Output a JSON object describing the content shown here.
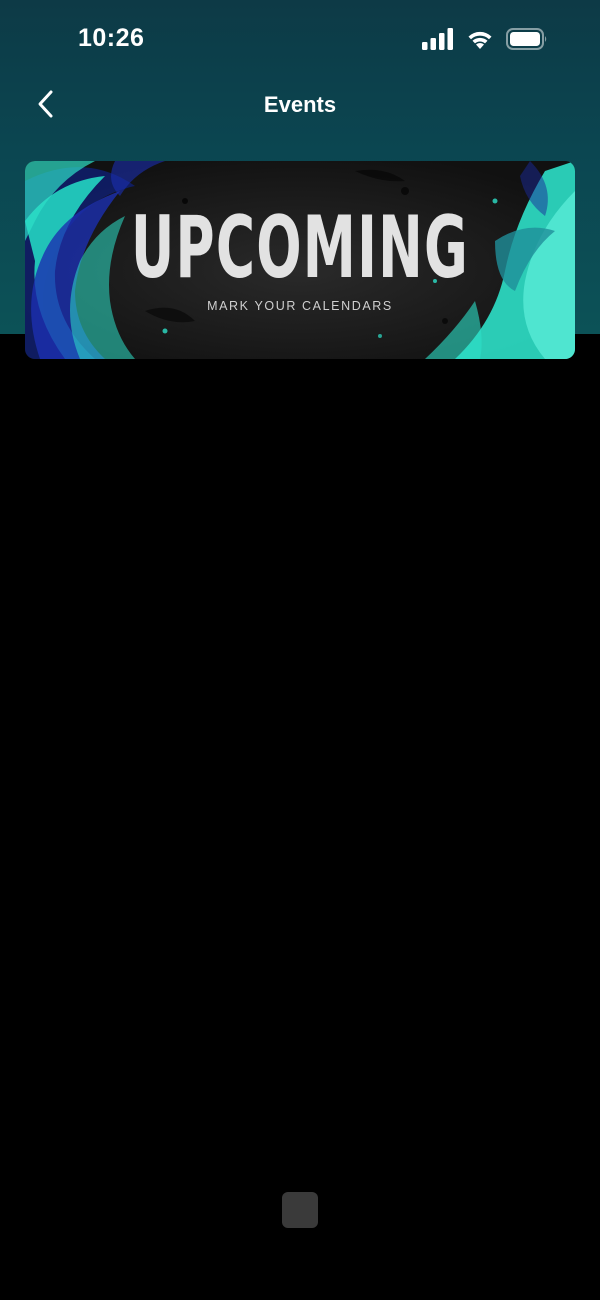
{
  "status_bar": {
    "time": "10:26",
    "signal_icon": "cellular-signal-icon",
    "wifi_icon": "wifi-icon",
    "battery_icon": "battery-icon"
  },
  "nav": {
    "title": "Events",
    "back_icon": "chevron-left-icon"
  },
  "banner": {
    "headline": "UPCOMING",
    "subtitle": "MARK YOUR CALENDARS"
  },
  "colors": {
    "header_gradient_top": "#0d3a46",
    "header_gradient_bottom": "#0c5257",
    "background": "#000000",
    "banner_accent": "#2de0c8",
    "banner_accent_dark": "#1a2a9a"
  }
}
